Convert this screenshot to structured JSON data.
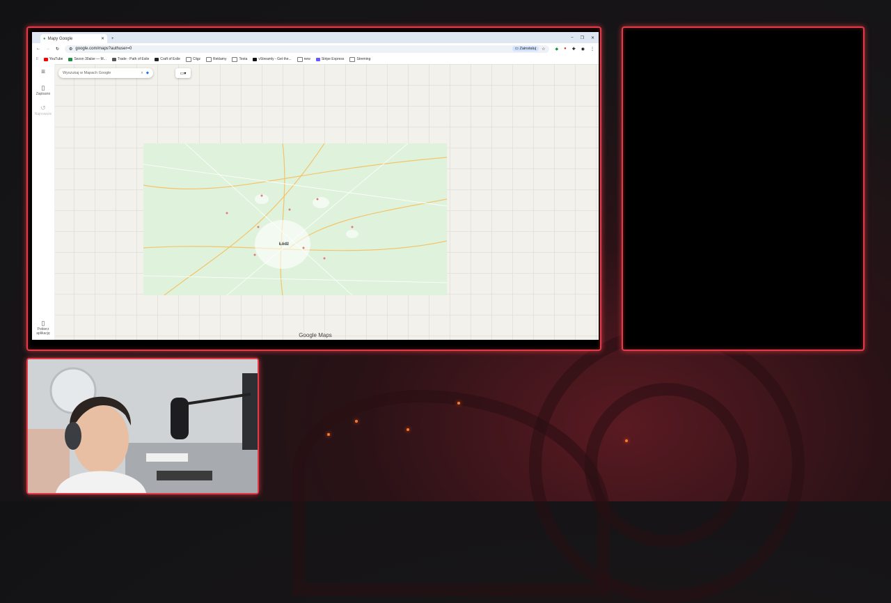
{
  "browser": {
    "tab_title": "Mapy Google",
    "address": "google.com/maps?authuser=0",
    "install_label": "Zainstaluj",
    "bookmarks": [
      {
        "label": "YouTube",
        "color": "#ff0000"
      },
      {
        "label": "Sezon 30alse — M...",
        "color": "#1e8e3e"
      },
      {
        "label": "Trade - Path of Exile",
        "color": "#555555"
      },
      {
        "label": "Craft of Exile",
        "color": "#222222"
      },
      {
        "label": "Cligz",
        "color": "#8a8a8a"
      },
      {
        "label": "Reklamy",
        "color": "#8a8a8a"
      },
      {
        "label": "Testa",
        "color": "#8a8a8a"
      },
      {
        "label": "vStreamly - Get the...",
        "color": "#111111"
      },
      {
        "label": "new",
        "color": "#8a8a8a"
      },
      {
        "label": "Stripe Express",
        "color": "#635bff"
      },
      {
        "label": "Streming",
        "color": "#8a8a8a"
      }
    ]
  },
  "maps": {
    "search_placeholder": "Wyszukaj w Mapach Google",
    "rail_saved": "Zapisano",
    "rail_recent": "Najnowsze",
    "rail_download": "Pobierz aplikację",
    "city_label": "Łódź",
    "wordmark": "Google Maps"
  },
  "colors": {
    "frame_accent": "#e23b4a",
    "maps_bg": "#f3f1ec",
    "map_tile": "#dff3dc"
  }
}
